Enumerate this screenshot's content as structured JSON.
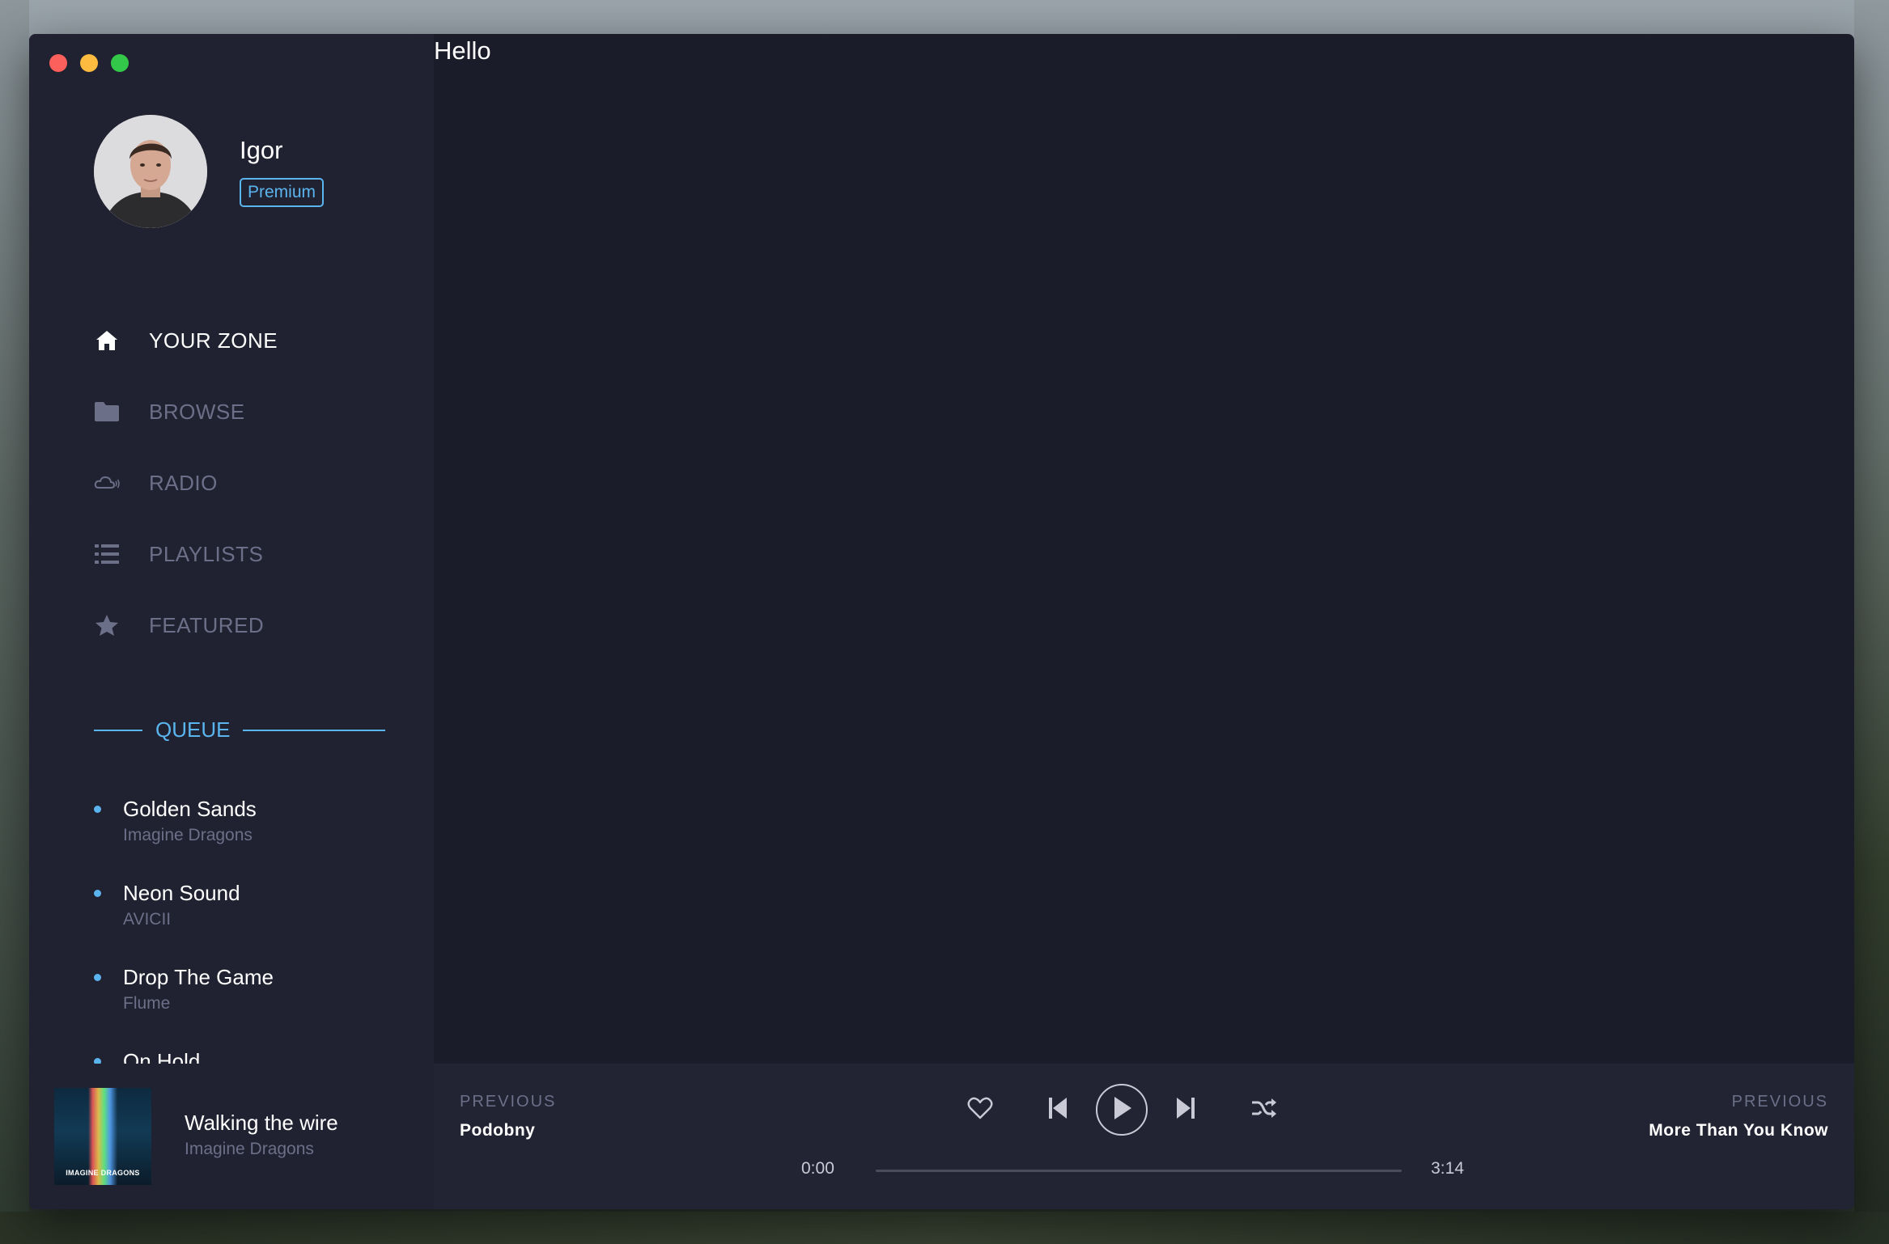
{
  "app": {
    "greeting": "Hello"
  },
  "user": {
    "name": "Igor",
    "plan": "Premium"
  },
  "sidebar": {
    "nav": [
      {
        "label": "YOUR ZONE",
        "icon": "home-icon",
        "active": true
      },
      {
        "label": "BROWSE",
        "icon": "folder-icon",
        "active": false
      },
      {
        "label": "RADIO",
        "icon": "cloud-radio-icon",
        "active": false
      },
      {
        "label": "PLAYLISTS",
        "icon": "list-icon",
        "active": false
      },
      {
        "label": "FEATURED",
        "icon": "star-icon",
        "active": false
      }
    ]
  },
  "queue": {
    "title": "QUEUE",
    "items": [
      {
        "track": "Golden Sands",
        "artist": "Imagine Dragons"
      },
      {
        "track": "Neon Sound",
        "artist": "AVICII"
      },
      {
        "track": "Drop The Game",
        "artist": "Flume"
      },
      {
        "track": "On Hold",
        "artist": ""
      }
    ]
  },
  "player": {
    "now_playing": {
      "title": "Walking the wire",
      "artist": "Imagine Dragons",
      "cover_text": "IMAGINE DRAGONS"
    },
    "previous": {
      "label": "PREVIOUS",
      "track": "Podobny"
    },
    "next": {
      "label": "PREVIOUS",
      "track": "More Than You Know"
    },
    "time_current": "0:00",
    "time_total": "3:14",
    "progress": 0,
    "controls": [
      "heart-icon",
      "skip-back-icon",
      "play-icon",
      "skip-forward-icon",
      "shuffle-icon"
    ]
  },
  "colors": {
    "accent": "#5ab4ee",
    "window_bg": "#1b1c29",
    "sidebar_bg": "#212231",
    "muted_text": "#6c6f88",
    "text": "#ffffff"
  }
}
